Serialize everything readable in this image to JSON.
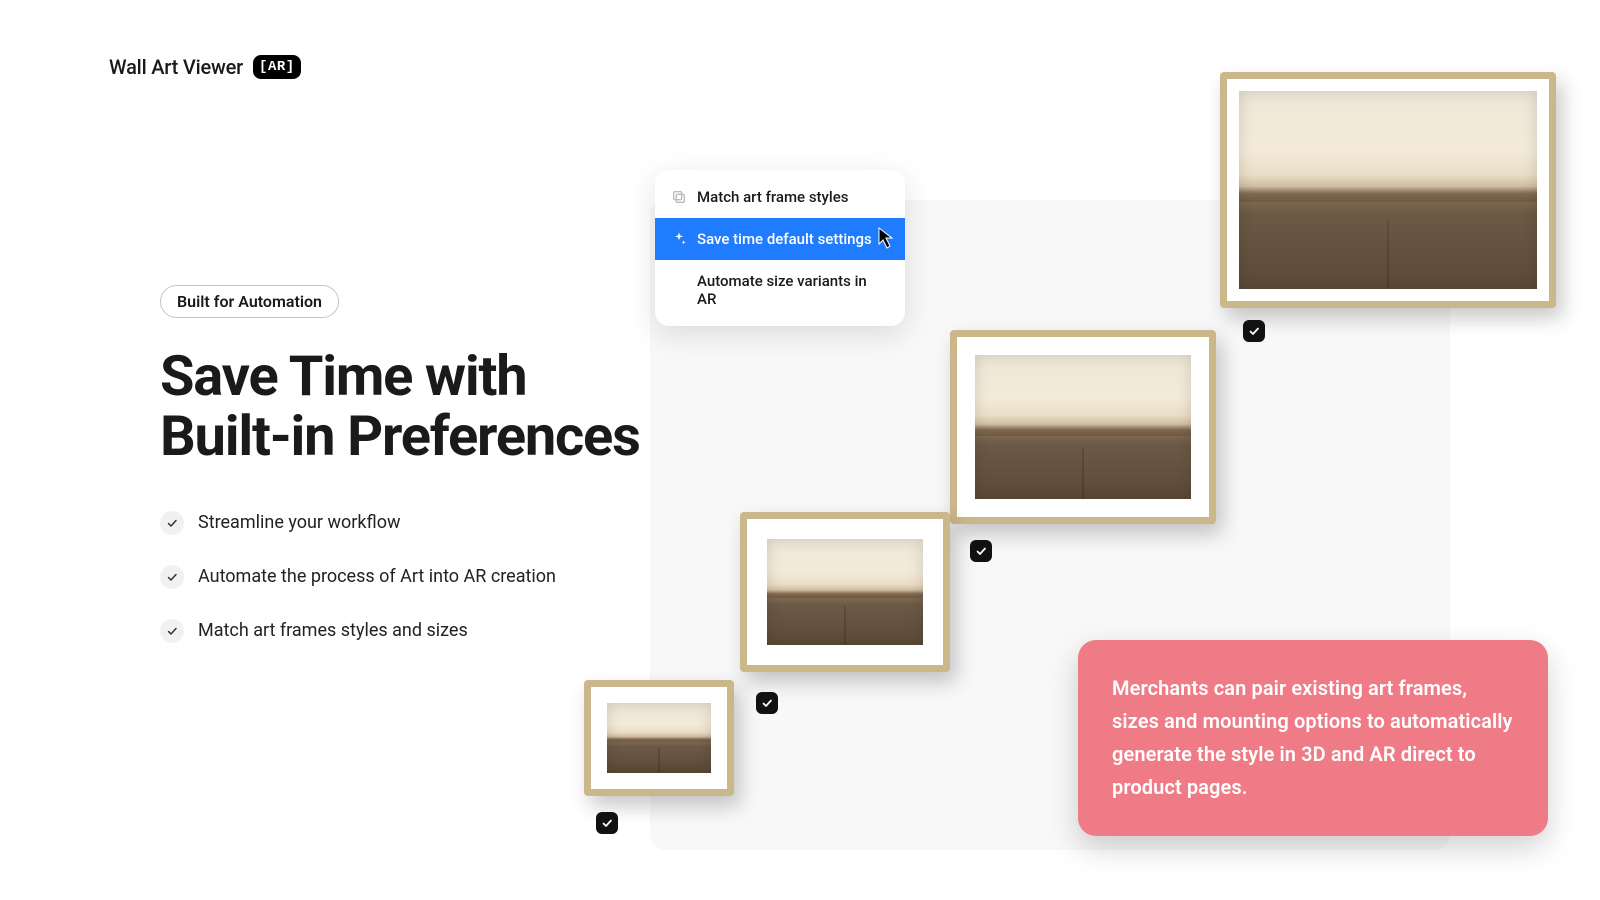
{
  "brand": {
    "name": "Wall Art Viewer",
    "badge": "[AR]"
  },
  "copy": {
    "chip": "Built for Automation",
    "headline_l1": "Save Time with",
    "headline_l2": "Built-in Preferences",
    "bullets": [
      "Streamline your workflow",
      "Automate the process of Art into AR creation",
      "Match art frames styles and sizes"
    ]
  },
  "menu": {
    "items": [
      {
        "label": "Match art frame styles",
        "icon": "select-icon",
        "active": false
      },
      {
        "label": "Save time default settings",
        "icon": "sparkle-icon",
        "active": true
      },
      {
        "label": "Automate size variants in AR",
        "icon": "",
        "active": false
      }
    ]
  },
  "callout": "Merchants can pair existing art frames, sizes and mounting options to automatically generate the style in 3D and AR direct to product pages."
}
